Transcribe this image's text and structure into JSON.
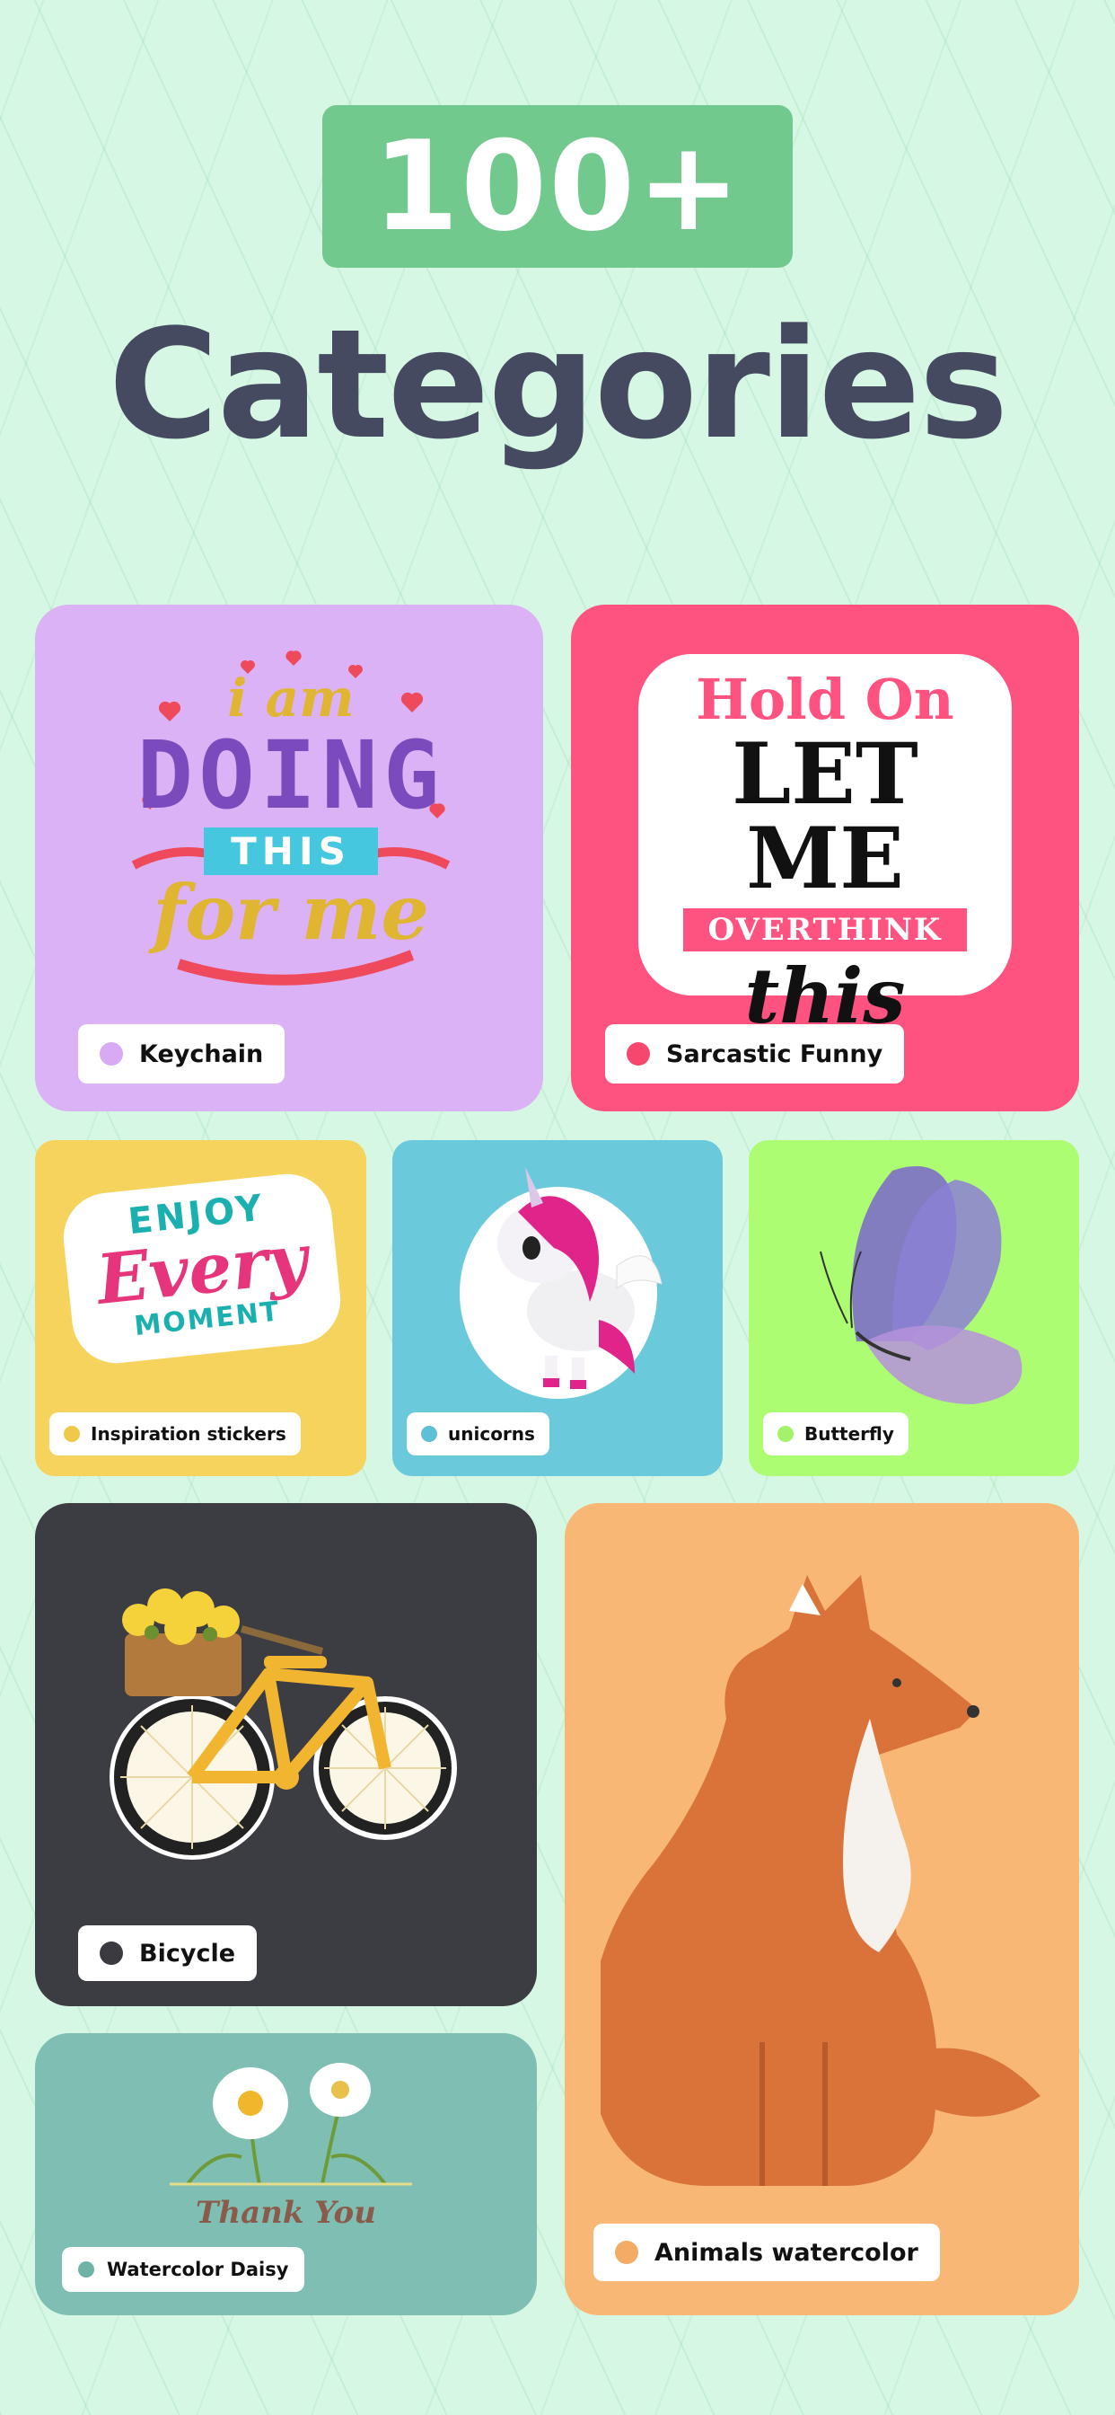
{
  "hero": {
    "badge": "100+",
    "title": "Categories"
  },
  "cards": {
    "keychain": {
      "label": "Keychain",
      "bg": "#dbb2f5",
      "dot": "#d9aaf4",
      "sticker": {
        "line1": "i am",
        "line2": "DOING",
        "line3": "THIS",
        "line4": "for me"
      }
    },
    "sarcastic": {
      "label": "Sarcastic Funny",
      "bg": "#fe5280",
      "dot": "#f6486f",
      "sticker": {
        "line1": "Hold On",
        "line2": "LET ME",
        "line3": "OVERTHINK",
        "line4": "this"
      }
    },
    "inspiration": {
      "label": "Inspiration stickers",
      "bg": "#f6d35c",
      "dot": "#f1c94a",
      "sticker": {
        "line1": "ENJOY",
        "line2": "Every",
        "line3": "MOMENT"
      }
    },
    "unicorns": {
      "label": "unicorns",
      "bg": "#6ac9db",
      "dot": "#5fbfd6"
    },
    "butterfly": {
      "label": "Butterfly",
      "bg": "#adfd73",
      "dot": "#a4f26a"
    },
    "bicycle": {
      "label": "Bicycle",
      "bg": "#3c3c43",
      "dot": "#3a3a40"
    },
    "daisy": {
      "label": "Watercolor Daisy",
      "bg": "#7fbfb3",
      "dot": "#6fb3a6",
      "sticker": {
        "caption": "Thank You"
      }
    },
    "animals": {
      "label": "Animals watercolor",
      "bg": "#f9b776",
      "dot": "#f3ab66"
    }
  }
}
